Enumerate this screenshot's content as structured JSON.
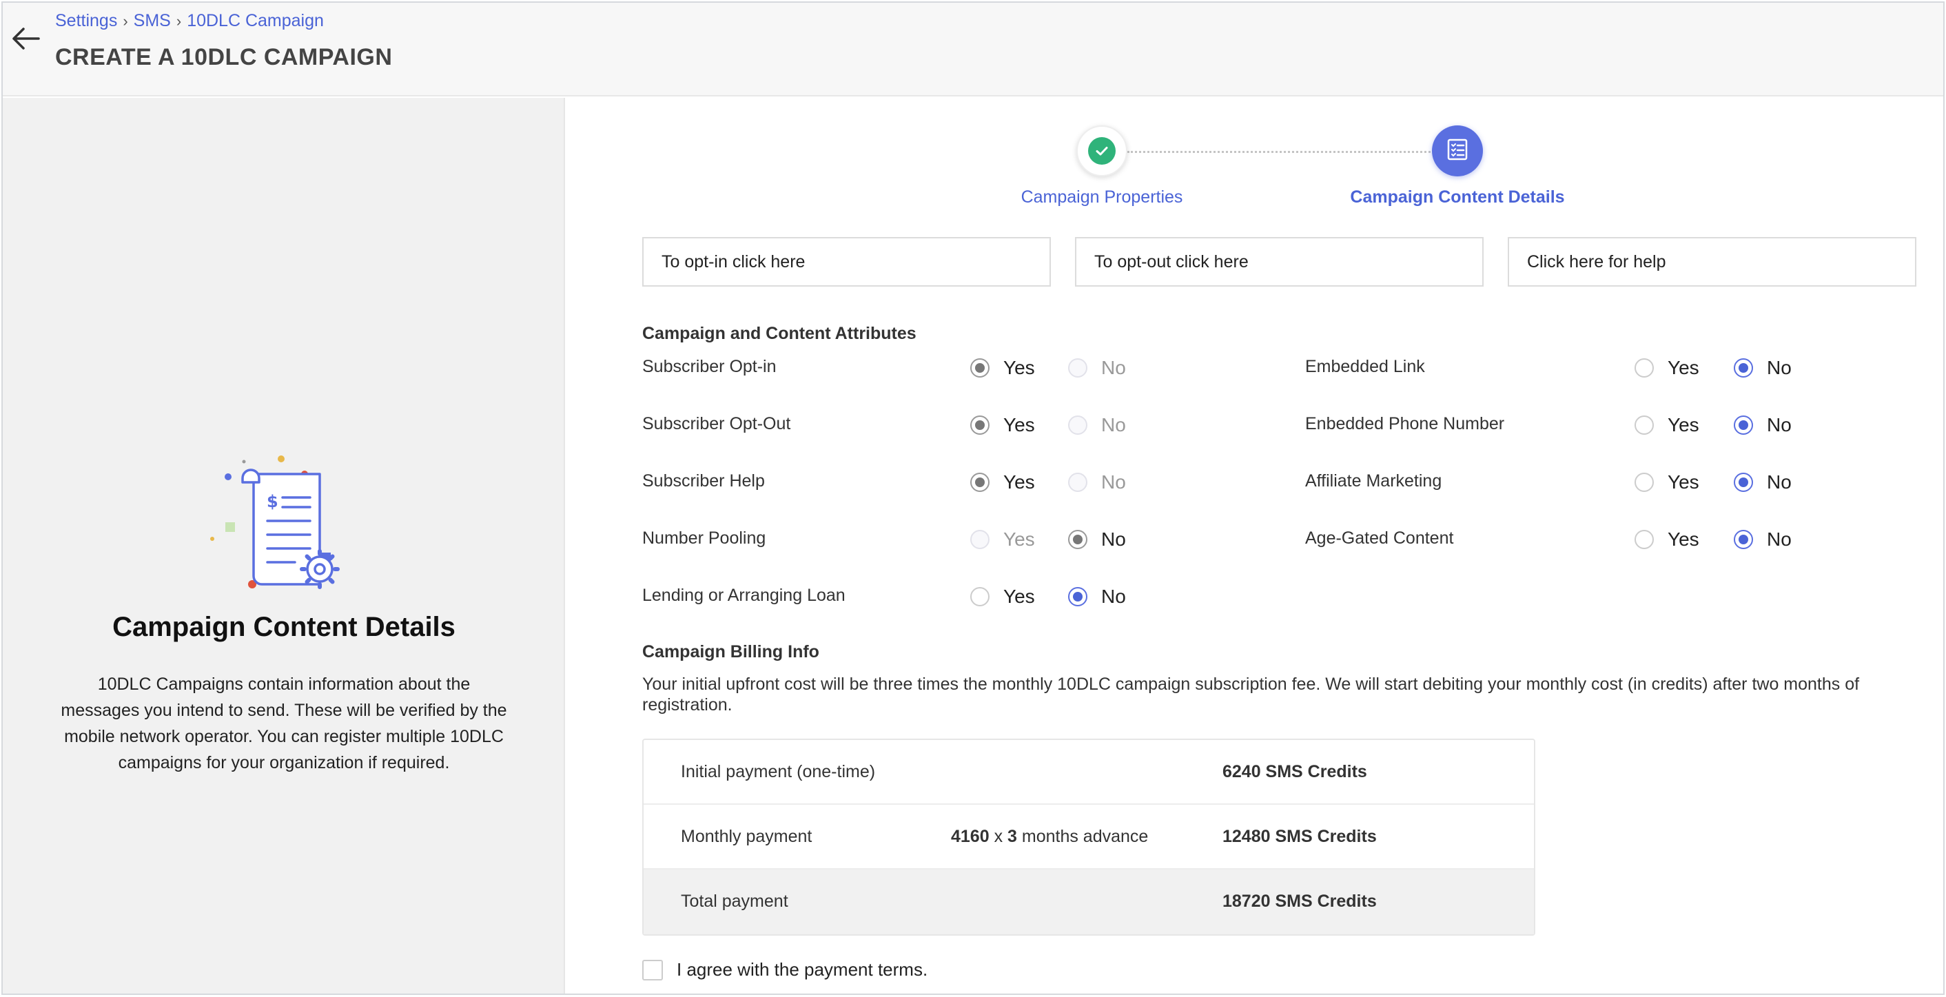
{
  "header": {
    "breadcrumb": [
      "Settings",
      "SMS",
      "10DLC Campaign"
    ],
    "title": "CREATE A 10DLC CAMPAIGN"
  },
  "left_panel": {
    "heading": "Campaign Content Details",
    "description": "10DLC Campaigns contain information about the messages you intend to send. These will be verified by the mobile network operator. You can register multiple 10DLC campaigns for your organization if required."
  },
  "stepper": {
    "steps": [
      {
        "label": "Campaign Properties",
        "state": "complete"
      },
      {
        "label": "Campaign Content Details",
        "state": "active"
      }
    ]
  },
  "links": {
    "opt_in": "To opt-in click here",
    "opt_out": "To opt-out click here",
    "help": "Click here for help"
  },
  "attributes": {
    "title": "Campaign and Content Attributes",
    "yes": "Yes",
    "no": "No",
    "left": [
      {
        "label": "Subscriber Opt-in",
        "value": "Yes"
      },
      {
        "label": "Subscriber Opt-Out",
        "value": "Yes"
      },
      {
        "label": "Subscriber Help",
        "value": "Yes"
      },
      {
        "label": "Number Pooling",
        "value": "No"
      },
      {
        "label": "Lending or Arranging Loan",
        "value": "No"
      }
    ],
    "right": [
      {
        "label": "Embedded Link",
        "value": "No"
      },
      {
        "label": "Enbedded Phone Number",
        "value": "No"
      },
      {
        "label": "Affiliate Marketing",
        "value": "No"
      },
      {
        "label": "Age-Gated Content",
        "value": "No"
      }
    ]
  },
  "billing": {
    "title": "Campaign Billing Info",
    "description": "Your initial upfront cost will be three times the monthly 10DLC campaign subscription fee. We will start debiting your monthly cost (in credits) after two months of registration.",
    "rows": [
      {
        "label": "Initial payment (one-time)",
        "amount": "6240 SMS Credits"
      },
      {
        "label": "Monthly payment",
        "calc_value": "4160",
        "calc_x": " x ",
        "calc_months": "3",
        "calc_suffix": " months advance",
        "amount": "12480 SMS Credits"
      },
      {
        "label": "Total payment",
        "amount": "18720 SMS Credits"
      }
    ]
  },
  "agree": {
    "label": "I agree with the payment terms.",
    "checked": false
  },
  "colors": {
    "accent": "#4a63d6",
    "success": "#2fb37a",
    "step_active": "#5a6fe0"
  }
}
